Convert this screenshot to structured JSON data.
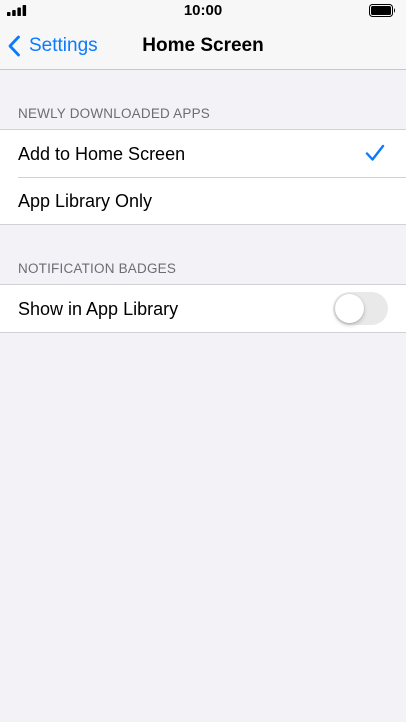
{
  "status_bar": {
    "time": "10:00",
    "signal_icon": "signal-bars-icon",
    "battery_icon": "battery-full-icon"
  },
  "nav": {
    "back_label": "Settings",
    "back_icon": "chevron-left-icon",
    "title": "Home Screen"
  },
  "sections": {
    "newly_downloaded": {
      "header": "NEWLY DOWNLOADED APPS",
      "options": [
        {
          "label": "Add to Home Screen",
          "selected": true
        },
        {
          "label": "App Library Only",
          "selected": false
        }
      ]
    },
    "notification_badges": {
      "header": "NOTIFICATION BADGES",
      "toggle": {
        "label": "Show in App Library",
        "on": false
      }
    }
  },
  "colors": {
    "accent": "#0A7AFF",
    "background": "#F2F2F7",
    "toggle_off": "#E9E9EA"
  }
}
